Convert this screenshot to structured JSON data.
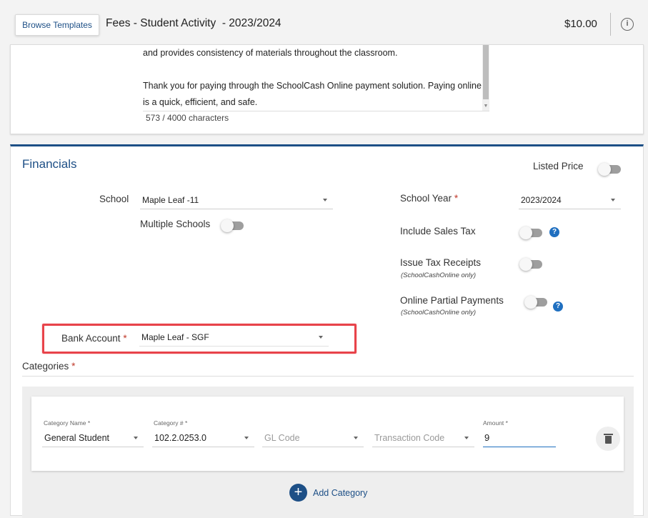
{
  "header": {
    "browse_label": "Browse Templates",
    "title": "Fees - Student Activity  - 2023/2024",
    "total": "$10.00"
  },
  "description": {
    "para1": "and provides consistency of materials throughout the classroom.",
    "para2": "Thank you for paying through the SchoolCash Online payment solution.  Paying online is a quick, efficient, and safe.",
    "char_count": "573  /  4000   characters"
  },
  "financials": {
    "title": "Financials",
    "listed_price_label": "Listed Price",
    "school_label": "School",
    "school_value": "Maple Leaf -11",
    "multiple_schools_label": "Multiple Schools",
    "school_year_label": "School Year",
    "school_year_value": "2023/2024",
    "include_tax_label": "Include Sales Tax",
    "issue_receipts_label": "Issue Tax Receipts",
    "issue_receipts_sub": "(SchoolCashOnline only)",
    "partial_label": "Online Partial Payments",
    "partial_sub": "(SchoolCashOnline only)",
    "bank_label": "Bank Account",
    "bank_value": "Maple Leaf - SGF",
    "required_mark": "*"
  },
  "categories": {
    "title": "Categories",
    "name_label": "Category Name *",
    "name_value": "General Student",
    "number_label": "Category # *",
    "number_value": "102.2.0253.0",
    "gl_placeholder": "GL Code",
    "transaction_placeholder": "Transaction Code",
    "amount_label": "Amount *",
    "amount_value": "9",
    "add_label": "Add Category"
  },
  "colors": {
    "accent": "#1d4f86",
    "highlight": "#e8434a",
    "help": "#1f6fc0"
  }
}
